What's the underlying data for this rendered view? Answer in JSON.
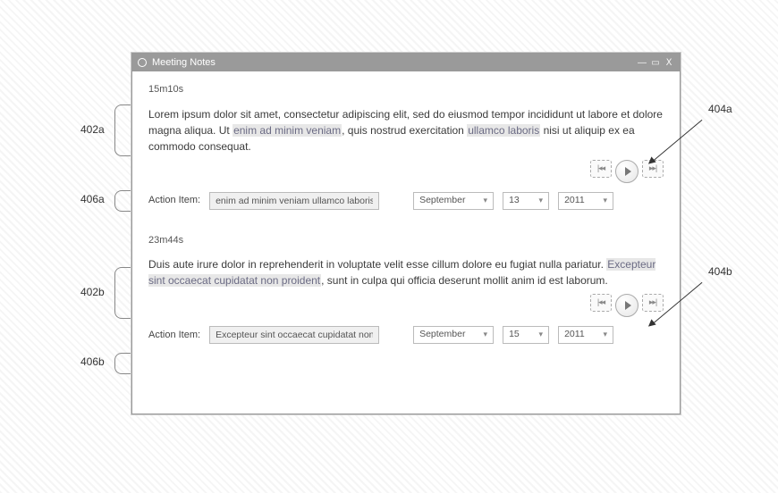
{
  "window": {
    "title": "Meeting Notes",
    "controls": {
      "min": "—",
      "max": "▭",
      "close": "Ⅹ"
    }
  },
  "notes": [
    {
      "timestamp": "15m10s",
      "text_parts": [
        {
          "t": "Lorem ipsum dolor sit amet, consectetur adipiscing elit, sed do eiusmod tempor incididunt ut labore et dolore magna aliqua. Ut ",
          "hl": false
        },
        {
          "t": "enim ad minim veniam",
          "hl": true
        },
        {
          "t": ", quis nostrud exercitation ",
          "hl": false
        },
        {
          "t": "ullamco laboris",
          "hl": true
        },
        {
          "t": " nisi ut aliquip ex ea commodo consequat.",
          "hl": false
        }
      ],
      "action_item": "enim ad minim veniam ullamco laboris",
      "date": {
        "month": "September",
        "day": "13",
        "year": "2011"
      }
    },
    {
      "timestamp": "23m44s",
      "text_parts": [
        {
          "t": "Duis aute irure dolor in reprehenderit in voluptate velit esse cillum dolore eu fugiat nulla pariatur. ",
          "hl": false
        },
        {
          "t": "Excepteur sint occaecat cupidatat non proident",
          "hl": true
        },
        {
          "t": ", sunt in culpa qui officia deserunt mollit anim id est laborum.",
          "hl": false
        }
      ],
      "action_item": "Excepteur sint occaecat cupidatat non proident",
      "date": {
        "month": "September",
        "day": "15",
        "year": "2011"
      }
    }
  ],
  "labels": {
    "action_item": "Action Item:",
    "player": {
      "prev": "|◂◂",
      "next": "▸▸|"
    }
  },
  "callouts": {
    "a_para": "402a",
    "a_play": "404a",
    "a_act": "406a",
    "b_para": "402b",
    "b_play": "404b",
    "b_act": "406b"
  }
}
